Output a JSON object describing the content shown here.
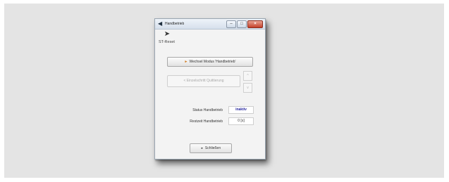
{
  "window": {
    "title": "Handbetrieb",
    "title_icon": "arrow-left-icon"
  },
  "st_reset": {
    "icon": "diamond-arrow-icon",
    "label": "ST-Reset"
  },
  "buttons": {
    "mode_switch": "Wechsel Modus 'Handbetrieb'",
    "quit": "< Einzelschritt Quittierung",
    "spin_up": "^",
    "spin_down": "v",
    "close": "Schließen"
  },
  "status": {
    "status_label": "Status Handbetrieb",
    "status_value": "inaktiv",
    "rest_label": "Restzeit Handbetrieb",
    "rest_value": "0 [s]"
  },
  "colors": {
    "accent_arrow": "#d27a1c",
    "status_value": "#2a2aa0",
    "close_button": "#c4412a"
  }
}
